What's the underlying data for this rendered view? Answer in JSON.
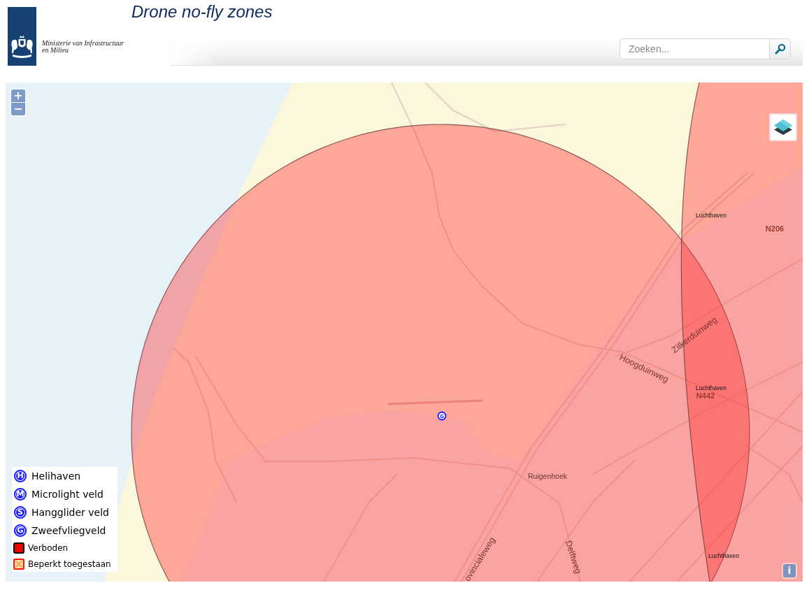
{
  "header": {
    "logo_text": [
      "Ministerie van Infrastructuur",
      "en Milieu"
    ],
    "title": "Drone no-fly zones",
    "search": {
      "placeholder": "Zoeken..."
    }
  },
  "map": {
    "zoom_buttons": [
      {
        "label": "+"
      },
      {
        "label": "−"
      }
    ],
    "labels": [
      {
        "text": "Luchthaven",
        "kind": "airport"
      },
      {
        "text": "N206",
        "kind": "route"
      },
      {
        "text": "Zilkerduinweg",
        "kind": "road"
      },
      {
        "text": "Hoogduinweg",
        "kind": "road"
      },
      {
        "text": "Luchthaven",
        "kind": "airport"
      },
      {
        "text": "N442",
        "kind": "route"
      },
      {
        "text": "Ruigenhoek",
        "kind": "place"
      },
      {
        "text": "ovincialeweg",
        "kind": "road"
      },
      {
        "text": "Delftweg",
        "kind": "road"
      },
      {
        "text": "Luchthaven",
        "kind": "airport"
      }
    ],
    "marker": {
      "symbol": "G"
    },
    "legend": [
      {
        "kind": "letter",
        "symbol": "H",
        "label": "Helihaven"
      },
      {
        "kind": "letter",
        "symbol": "M",
        "label": "Microlight veld"
      },
      {
        "kind": "letter",
        "symbol": "S",
        "label": "Hangglider veld"
      },
      {
        "kind": "letter",
        "symbol": "G",
        "label": "Zweefvliegveld"
      },
      {
        "kind": "solid",
        "label": "Verboden"
      },
      {
        "kind": "crossed",
        "label": "Beperkt toegestaan"
      }
    ],
    "info_button": {
      "label": "i"
    }
  }
}
